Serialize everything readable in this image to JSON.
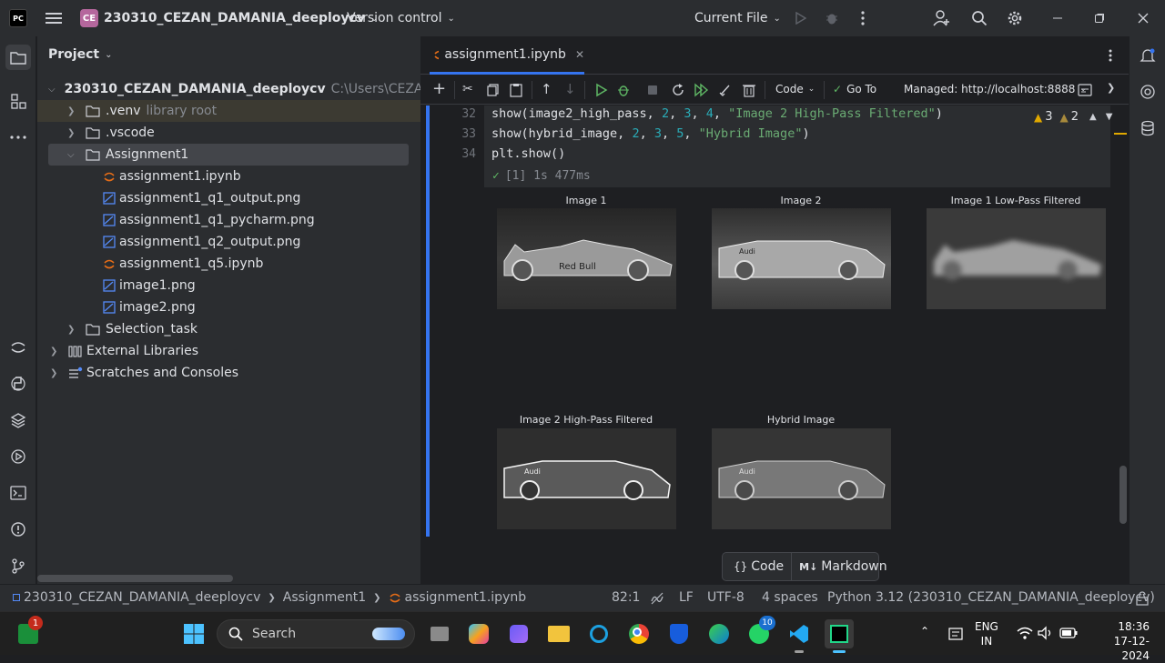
{
  "titlebar": {
    "app_logo": "PC",
    "project_badge": "CE",
    "project_name": "230310_CEZAN_DAMANIA_deeploycv",
    "version_control": "Version control",
    "run_config": "Current File"
  },
  "project_panel": {
    "title": "Project",
    "root_name": "230310_CEZAN_DAMANIA_deeploycv",
    "root_path": "C:\\Users\\CEZAN DAM",
    "items": [
      {
        "label": ".venv",
        "hint": "library root"
      },
      {
        "label": ".vscode"
      },
      {
        "label": "Assignment1"
      },
      {
        "label": "assignment1.ipynb"
      },
      {
        "label": "assignment1_q1_output.png"
      },
      {
        "label": "assignment1_q1_pycharm.png"
      },
      {
        "label": "assignment1_q2_output.png"
      },
      {
        "label": "assignment1_q5.ipynb"
      },
      {
        "label": "image1.png"
      },
      {
        "label": "image2.png"
      },
      {
        "label": "Selection_task"
      },
      {
        "label": "External Libraries"
      },
      {
        "label": "Scratches and Consoles"
      }
    ]
  },
  "editor": {
    "tab_label": "assignment1.ipynb",
    "toolbar": {
      "cell_type": "Code",
      "goto": "Go To",
      "server": "Managed: http://localhost:8888"
    },
    "inspections": {
      "warnings": "3",
      "weak_warnings": "2"
    },
    "lines": [
      {
        "num": "32",
        "parts": [
          [
            "show(image2_high_pass, ",
            ""
          ],
          [
            "2",
            "num"
          ],
          [
            ", ",
            ""
          ],
          [
            "3",
            "num"
          ],
          [
            ", ",
            ""
          ],
          [
            "4",
            "num"
          ],
          [
            ", ",
            ""
          ],
          [
            "\"Image 2 High-Pass Filtered\"",
            "str"
          ],
          [
            ")",
            ""
          ]
        ]
      },
      {
        "num": "33",
        "parts": [
          [
            "show(hybrid_image, ",
            ""
          ],
          [
            "2",
            "num"
          ],
          [
            ", ",
            ""
          ],
          [
            "3",
            "num"
          ],
          [
            ", ",
            ""
          ],
          [
            "5",
            "num"
          ],
          [
            ", ",
            ""
          ],
          [
            "\"Hybrid Image\"",
            "str"
          ],
          [
            ")",
            ""
          ]
        ]
      },
      {
        "num": "34",
        "parts": [
          [
            "plt.show()",
            ""
          ]
        ]
      }
    ],
    "exec_status": "[1] 1s 477ms",
    "figures": [
      {
        "title": "Image 1",
        "caption": "Red Bull"
      },
      {
        "title": "Image 2",
        "caption": "Audi"
      },
      {
        "title": "Image 1 Low-Pass Filtered",
        "caption": ""
      },
      {
        "title": "Image 2 High-Pass Filtered",
        "caption": "Audi"
      },
      {
        "title": "Hybrid Image",
        "caption": "Audi"
      }
    ],
    "add_code": "Code",
    "add_markdown": "Markdown"
  },
  "statusbar": {
    "crumb_project": "230310_CEZAN_DAMANIA_deeploycv",
    "crumb_folder": "Assignment1",
    "crumb_file": "assignment1.ipynb",
    "position": "82:1",
    "line_sep": "LF",
    "encoding": "UTF-8",
    "indent": "4 spaces",
    "interpreter": "Python 3.12 (230310_CEZAN_DAMANIA_deeploycv)"
  },
  "taskbar": {
    "search_placeholder": "Search",
    "badge_store": "1",
    "badge_whatsapp": "10",
    "lang": "ENG",
    "region": "IN",
    "time": "18:36",
    "date": "17-12-2024"
  },
  "colors": {
    "accent": "#3574f0",
    "string": "#6aab73",
    "number": "#2aacb8",
    "run_green": "#5fb865",
    "warning": "#e0a800"
  }
}
